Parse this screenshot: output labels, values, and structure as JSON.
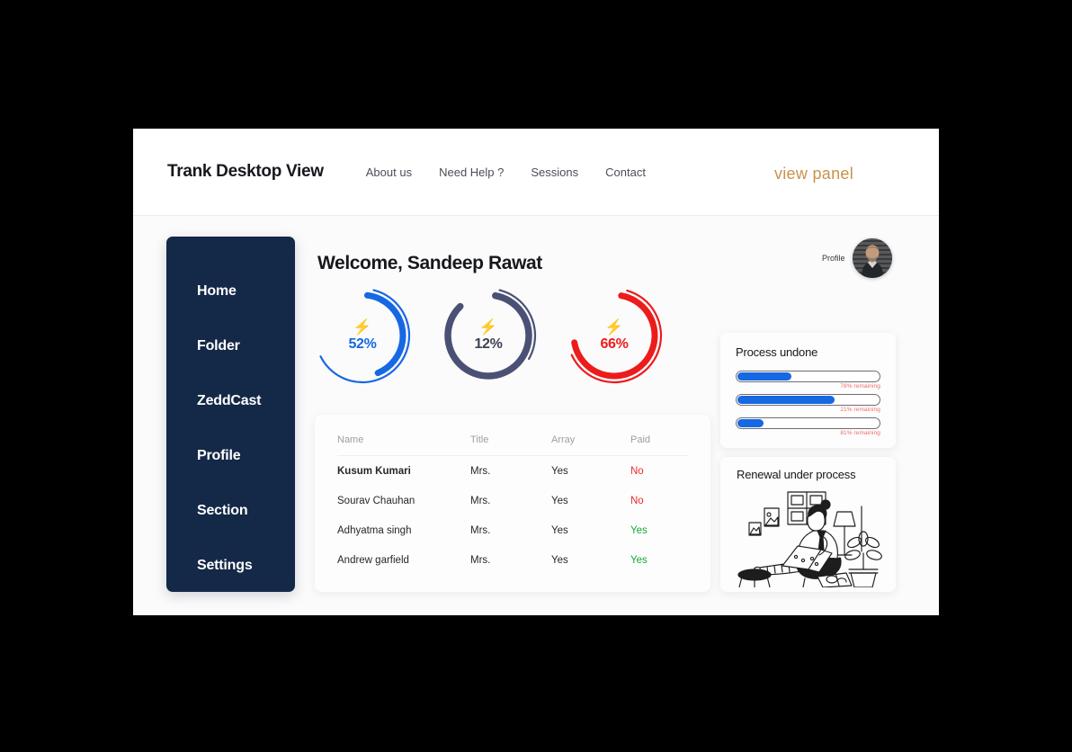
{
  "header": {
    "brand": "Trank Desktop View",
    "nav": [
      {
        "label": "About us"
      },
      {
        "label": "Need Help ?"
      },
      {
        "label": "Sessions"
      },
      {
        "label": "Contact"
      }
    ],
    "view_panel": "view panel",
    "accent_color": "#c8924a"
  },
  "sidebar": {
    "background": "#142847",
    "items": [
      {
        "label": "Home"
      },
      {
        "label": "Folder"
      },
      {
        "label": "ZeddCast"
      },
      {
        "label": "Profile"
      },
      {
        "label": "Section"
      },
      {
        "label": "Settings"
      }
    ]
  },
  "main": {
    "welcome": "Welcome, Sandeep Rawat",
    "profile_label": "Profile"
  },
  "rings": [
    {
      "value": "52%",
      "percent": 52,
      "color": "#1668e3",
      "icon": "lightning-bolt-icon",
      "icon_glyph": "⚡",
      "icon_color": "#f2c200"
    },
    {
      "value": "12%",
      "percent": 12,
      "color": "#4b5175",
      "icon": "lightning-bolt-icon",
      "icon_glyph": "⚡",
      "icon_color": "#f2c200"
    },
    {
      "value": "66%",
      "percent": 66,
      "color": "#ec1c1c",
      "icon": "lightning-bolt-icon",
      "icon_glyph": "⚡",
      "icon_color": "#f2c200"
    }
  ],
  "table": {
    "columns": [
      "Name",
      "Title",
      "Array",
      "Paid"
    ],
    "rows": [
      {
        "name": "Kusum Kumari",
        "title": "Mrs.",
        "array": "Yes",
        "paid": "No",
        "paid_state": "no"
      },
      {
        "name": "Sourav Chauhan",
        "title": "Mrs.",
        "array": "Yes",
        "paid": "No",
        "paid_state": "no"
      },
      {
        "name": "Adhyatma singh",
        "title": "Mrs.",
        "array": "Yes",
        "paid": "Yes",
        "paid_state": "yes"
      },
      {
        "name": "Andrew garfield",
        "title": "Mrs.",
        "array": "Yes",
        "paid": "Yes",
        "paid_state": "yes"
      }
    ],
    "paid_no_color": "#ef2b2b",
    "paid_yes_color": "#14a83c"
  },
  "process_card": {
    "title": "Process undone",
    "bar_color": "#1668e3",
    "note_color": "#f06a6a",
    "bars": [
      {
        "fill_percent": 40,
        "note": "78% remaining"
      },
      {
        "fill_percent": 70,
        "note": "21% remaining"
      },
      {
        "fill_percent": 19,
        "note": "81% remaining"
      }
    ]
  },
  "renewal_card": {
    "title": "Renewal under process",
    "illustration": "person-working-on-laptop-illustration"
  }
}
